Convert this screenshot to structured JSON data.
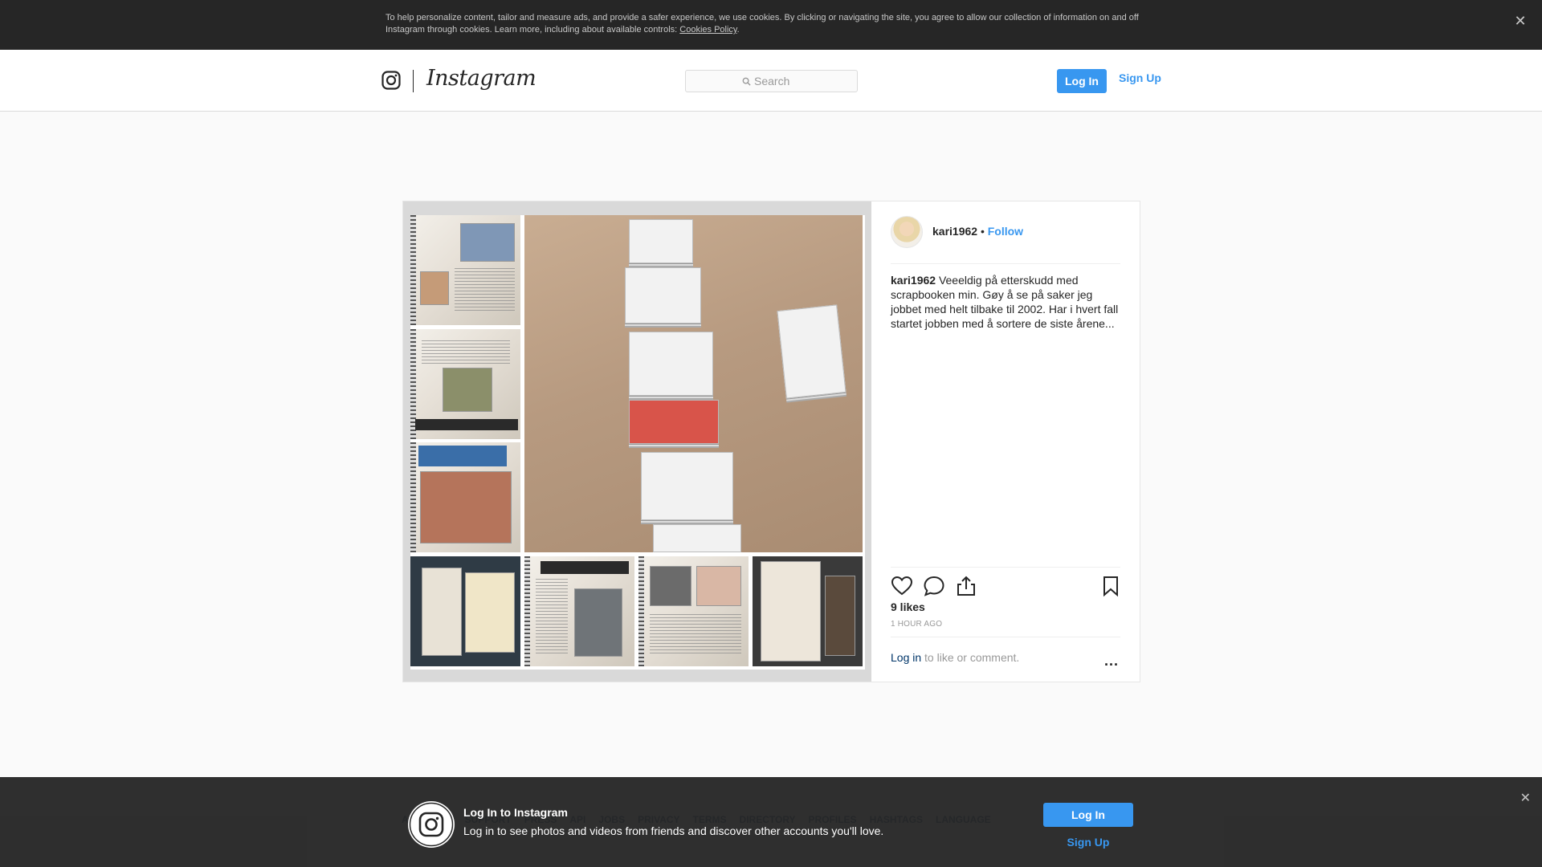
{
  "cookie_banner": {
    "text": "To help personalize content, tailor and measure ads, and provide a safer experience, we use cookies. By clicking or navigating the site, you agree to allow our collection of information on and off Instagram through cookies. Learn more, including about available controls: ",
    "link": "Cookies Policy",
    "end": ".",
    "close_icon": "close-icon"
  },
  "header": {
    "brand": "Instagram",
    "search_placeholder": "Search",
    "login": "Log In",
    "signup": "Sign Up"
  },
  "post": {
    "owner": "kari1962",
    "dot": " • ",
    "follow": "Follow",
    "caption_user": "kari1962",
    "caption_text": " Veeeldig på etterskudd med scrapbooken min. Gøy å se på saker jeg jobbet med helt tilbake til 2002. Har i hvert fall startet jobben med å sortere de siste årene...",
    "likes": "9 likes",
    "time": "1 HOUR AGO",
    "login_link": "Log in",
    "login_rest": " to like or comment.",
    "more": "...",
    "icons": [
      "heart-icon",
      "comment-icon",
      "share-icon",
      "bookmark-icon"
    ]
  },
  "footer_links": [
    "ABOUT US",
    "SUPPORT",
    "PRESS",
    "API",
    "JOBS",
    "PRIVACY",
    "TERMS",
    "DIRECTORY",
    "PROFILES",
    "HASHTAGS",
    "LANGUAGE"
  ],
  "bottom_bar": {
    "title": "Log In to Instagram",
    "subtitle": "Log in to see photos and videos from friends and discover other accounts you'll love.",
    "login": "Log In",
    "signup": "Sign Up"
  },
  "colors": {
    "accent": "#3897f0",
    "dark_bar": "#262626",
    "link_dark": "#003569"
  }
}
